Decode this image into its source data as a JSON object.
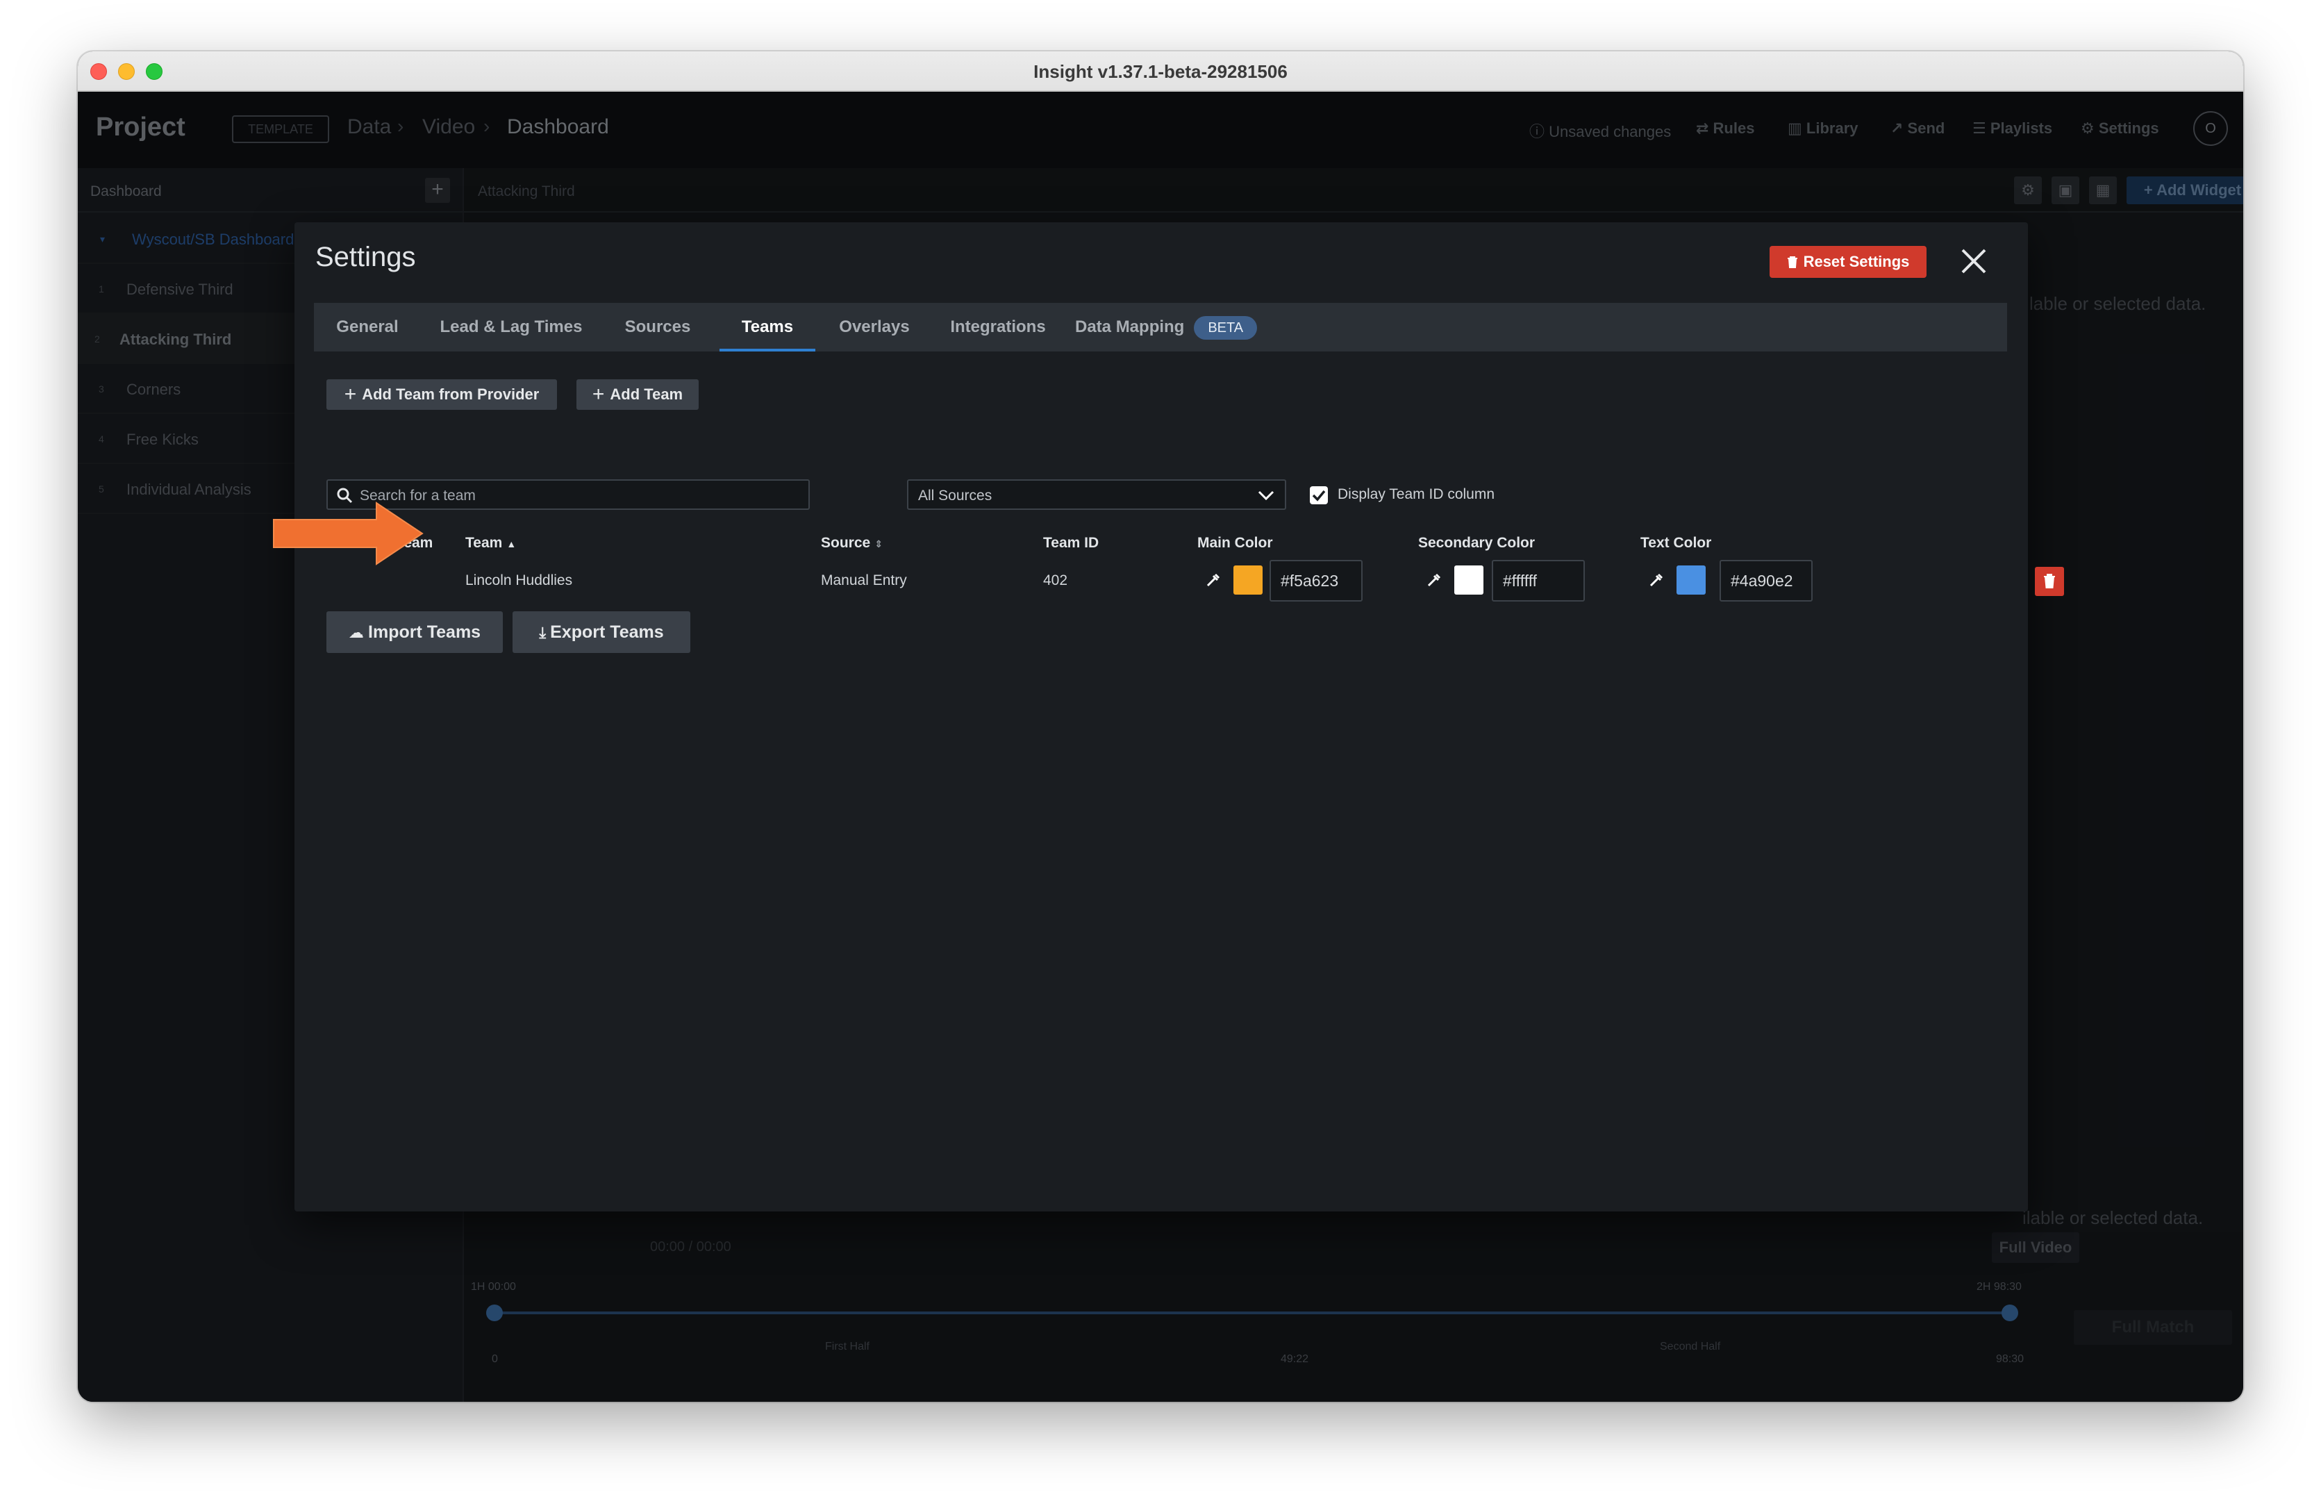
{
  "window": {
    "title": "Insight v1.37.1-beta-29281506"
  },
  "app": {
    "brand": "Project",
    "template_badge": "TEMPLATE",
    "breadcrumbs": [
      "Data",
      "Video",
      "Dashboard"
    ],
    "top_right": {
      "unsaved": "Unsaved changes",
      "rules": "Rules",
      "library": "Library",
      "send": "Send",
      "playlists": "Playlists",
      "settings": "Settings",
      "avatar": "O"
    }
  },
  "sidebar": {
    "title": "Dashboard",
    "tree_label": "Wyscout/SB Dashboard",
    "items": [
      {
        "num": "1",
        "label": "Defensive Third"
      },
      {
        "num": "2",
        "label": "Attacking Third"
      },
      {
        "num": "3",
        "label": "Corners"
      },
      {
        "num": "4",
        "label": "Free Kicks"
      },
      {
        "num": "5",
        "label": "Individual Analysis"
      }
    ]
  },
  "dashboard": {
    "tab_label": "Attacking Third",
    "add_widget": "Add Widget",
    "no_data_1": "lable or selected data.",
    "no_data_2": "ilable or selected data.",
    "full_video": "Full Video",
    "full_match": "Full Match",
    "timer": "00:00 / 00:00",
    "timeline": {
      "start": "1H 00:00",
      "end": "2H 98:30",
      "first_half": "First Half",
      "second_half": "Second Half",
      "tick_0": "0",
      "tick_mid": "49:22",
      "tick_end": "98:30"
    }
  },
  "settings_modal": {
    "title": "Settings",
    "reset_label": "Reset Settings",
    "tabs": [
      "General",
      "Lead & Lag Times",
      "Sources",
      "Teams",
      "Overlays",
      "Integrations",
      "Data Mapping"
    ],
    "active_tab": "Teams",
    "beta_badge": "BETA",
    "add_from_provider": "Add Team from Provider",
    "add_team": "Add Team",
    "search_placeholder": "Search for a team",
    "source_filter": "All Sources",
    "display_team_id_label": "Display Team ID column",
    "display_team_id_checked": true,
    "columns": {
      "primary": "Primary Team",
      "team": "Team",
      "source": "Source",
      "team_id": "Team ID",
      "main_color": "Main Color",
      "secondary_color": "Secondary Color",
      "text_color": "Text Color"
    },
    "rows": [
      {
        "team": "Lincoln Huddlies",
        "source": "Manual Entry",
        "team_id": "402",
        "main_color": "#f5a623",
        "secondary_color": "#ffffff",
        "text_color": "#4a90e2"
      }
    ],
    "import_label": "Import Teams",
    "export_label": "Export Teams"
  },
  "colors": {
    "accent_orange": "#f07030",
    "danger_red": "#d03a2c",
    "tab_active_underline": "#2f80d1"
  }
}
